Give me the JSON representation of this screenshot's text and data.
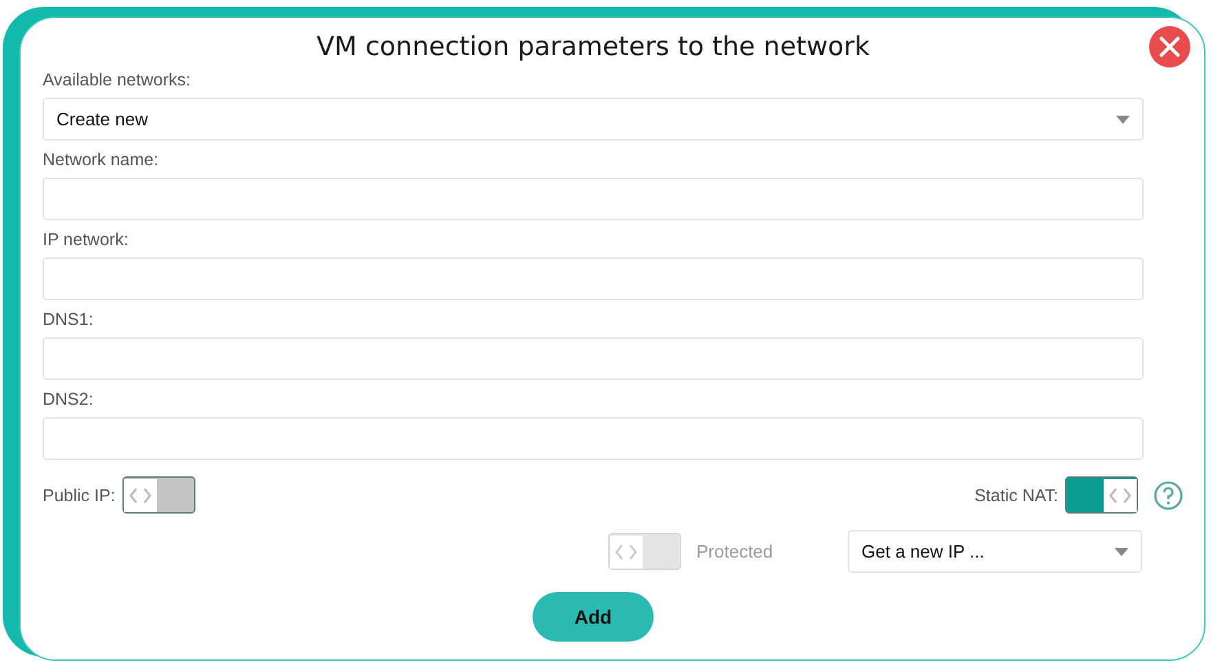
{
  "dialog": {
    "title": "VM connection parameters to the network"
  },
  "fields": [
    {
      "kind": "select",
      "label": "Available networks:",
      "value": "Create new"
    },
    {
      "kind": "text",
      "label": "Network name:"
    },
    {
      "kind": "text",
      "label": "IP network:"
    },
    {
      "kind": "text",
      "label": "DNS1:"
    },
    {
      "kind": "text",
      "label": "DNS2:"
    }
  ],
  "public_ip": {
    "label": "Public IP:",
    "on": false
  },
  "static_nat": {
    "label": "Static NAT:",
    "on": true
  },
  "protected": {
    "label": "Protected",
    "on": false,
    "disabled": true
  },
  "ip_select": {
    "value": "Get a new IP ..."
  },
  "add_button": {
    "label": "Add"
  }
}
